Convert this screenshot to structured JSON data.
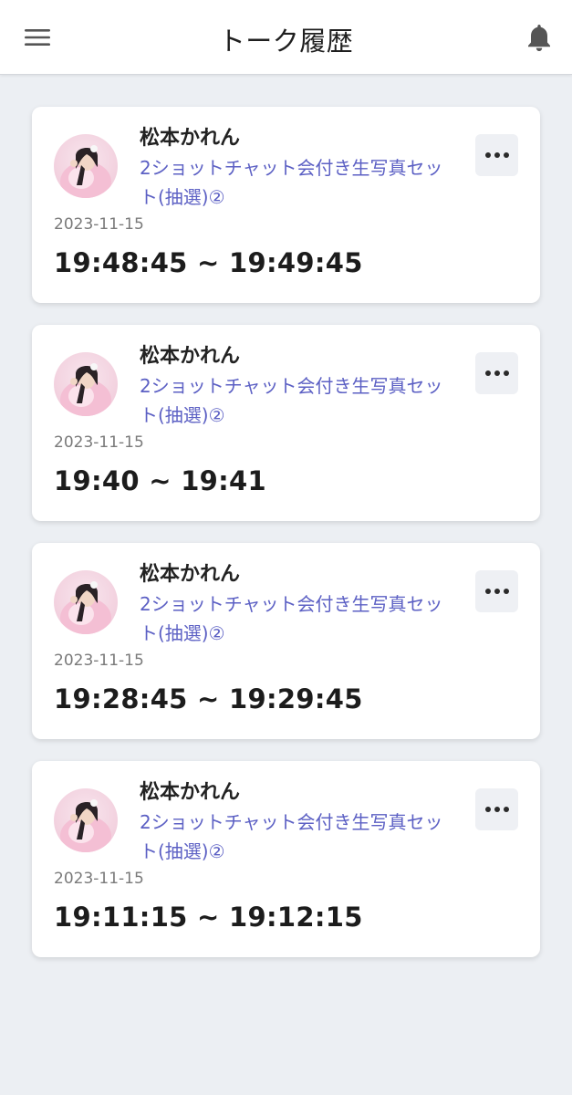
{
  "header": {
    "title": "トーク履歴",
    "menu_icon": "hamburger-menu-icon",
    "bell_icon": "bell-icon"
  },
  "colors": {
    "product_link": "#5c60c4",
    "background": "#eceff3"
  },
  "history": [
    {
      "name": "松本かれん",
      "product": "2ショットチャット会付き生写真セット(抽選)②",
      "date": "2023-11-15",
      "time": "19:48:45 ~ 19:49:45"
    },
    {
      "name": "松本かれん",
      "product": "2ショットチャット会付き生写真セット(抽選)②",
      "date": "2023-11-15",
      "time": "19:40 ~ 19:41"
    },
    {
      "name": "松本かれん",
      "product": "2ショットチャット会付き生写真セット(抽選)②",
      "date": "2023-11-15",
      "time": "19:28:45 ~ 19:29:45"
    },
    {
      "name": "松本かれん",
      "product": "2ショットチャット会付き生写真セット(抽選)②",
      "date": "2023-11-15",
      "time": "19:11:15 ~ 19:12:15"
    }
  ]
}
